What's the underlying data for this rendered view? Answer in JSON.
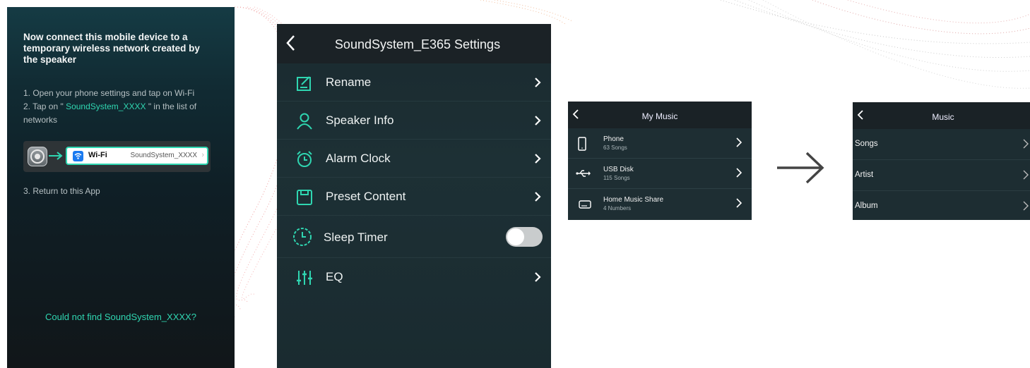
{
  "colors": {
    "accent": "#2fd6b1",
    "dark_bg": "#1b2a2f",
    "header_bg": "#1a2226"
  },
  "connect_screen": {
    "title": "Now connect this mobile device to a temporary wireless network created by the speaker",
    "step1": "1. Open your phone settings and tap on Wi-Fi",
    "step2_prefix": "2. Tap on \"",
    "step2_highlight": " SoundSystem_XXXX ",
    "step2_suffix": "\" in the list of networks",
    "wifi_label": "Wi-Fi",
    "wifi_value": "SoundSystem_XXXX",
    "step3": "3. Return to this App",
    "help_link": "Could not find SoundSystem_XXXX?"
  },
  "settings_screen": {
    "title": "SoundSystem_E365 Settings",
    "items": [
      {
        "label": "Rename",
        "icon": "edit-icon"
      },
      {
        "label": "Speaker Info",
        "icon": "person-icon"
      },
      {
        "label": "Alarm Clock",
        "icon": "alarm-clock-icon"
      },
      {
        "label": "Preset Content",
        "icon": "save-icon"
      },
      {
        "label": "Sleep Timer",
        "icon": "timer-icon",
        "toggle_on": false
      },
      {
        "label": "EQ",
        "icon": "equalizer-icon"
      }
    ]
  },
  "my_music_screen": {
    "title": "My Music",
    "items": [
      {
        "name": "Phone",
        "sub": "63 Songs",
        "icon": "phone-icon"
      },
      {
        "name": "USB Disk",
        "sub": "115 Songs",
        "icon": "usb-icon"
      },
      {
        "name": "Home Music Share",
        "sub": "4 Numbers",
        "icon": "drive-icon"
      }
    ]
  },
  "music_screen": {
    "title": "Music",
    "items": [
      {
        "label": "Songs"
      },
      {
        "label": "Artist"
      },
      {
        "label": "Album"
      }
    ]
  }
}
